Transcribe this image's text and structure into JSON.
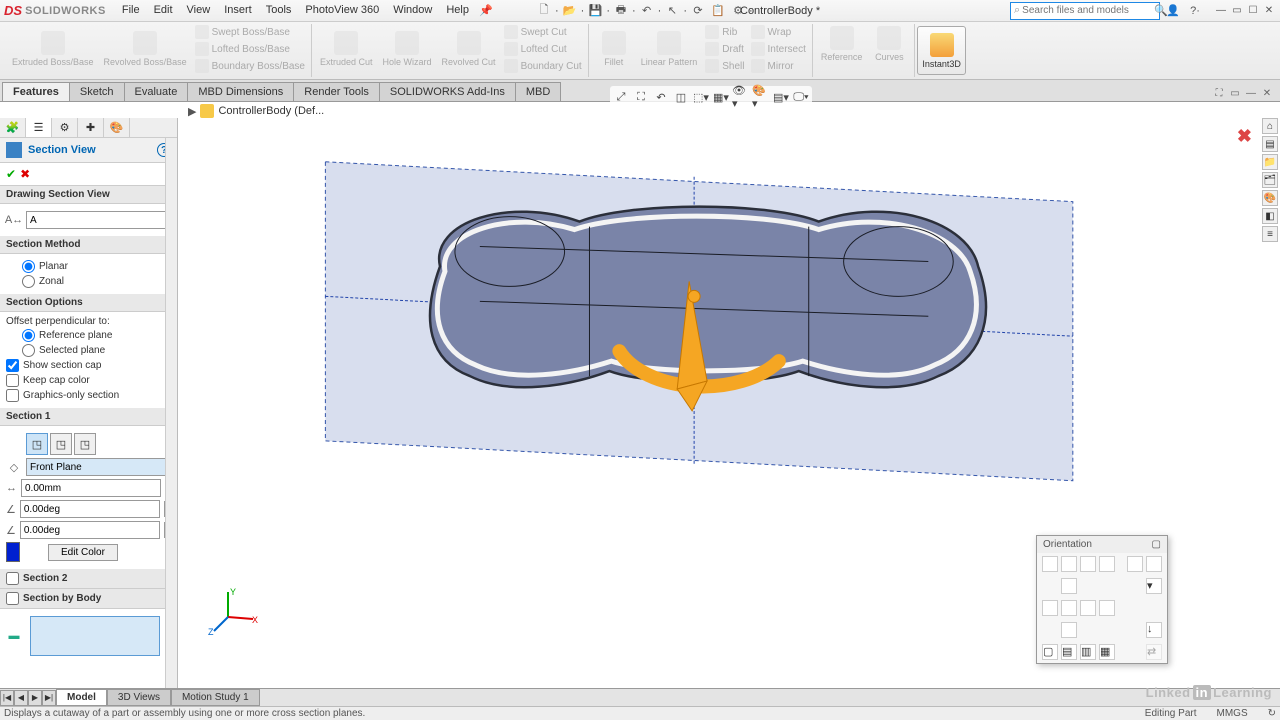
{
  "app": {
    "logo_ds": "DS",
    "logo_sw": "SOLIDWORKS",
    "doc_title": "ControllerBody *"
  },
  "menu": {
    "file": "File",
    "edit": "Edit",
    "view": "View",
    "insert": "Insert",
    "tools": "Tools",
    "photoview": "PhotoView 360",
    "window": "Window",
    "help": "Help"
  },
  "search": {
    "placeholder": "Search files and models"
  },
  "ribbon": {
    "extruded_boss": "Extruded Boss/Base",
    "revolved_boss": "Revolved Boss/Base",
    "swept_boss": "Swept Boss/Base",
    "lofted_boss": "Lofted Boss/Base",
    "boundary_boss": "Boundary Boss/Base",
    "extruded_cut": "Extruded Cut",
    "hole_wizard": "Hole Wizard",
    "revolved_cut": "Revolved Cut",
    "swept_cut": "Swept Cut",
    "lofted_cut": "Lofted Cut",
    "boundary_cut": "Boundary Cut",
    "fillet": "Fillet",
    "linear_pattern": "Linear Pattern",
    "rib": "Rib",
    "draft": "Draft",
    "shell": "Shell",
    "wrap": "Wrap",
    "intersect": "Intersect",
    "mirror": "Mirror",
    "reference": "Reference",
    "curves": "Curves",
    "instant3d": "Instant3D"
  },
  "tabs": {
    "features": "Features",
    "sketch": "Sketch",
    "evaluate": "Evaluate",
    "mbd_dim": "MBD Dimensions",
    "render": "Render Tools",
    "addins": "SOLIDWORKS Add-Ins",
    "mbd": "MBD"
  },
  "breadcrumb": {
    "doc": "ControllerBody  (Def..."
  },
  "pm": {
    "title": "Section View",
    "drawing_hdr": "Drawing Section View",
    "drawing_letter": "A",
    "method_hdr": "Section Method",
    "method_planar": "Planar",
    "method_zonal": "Zonal",
    "options_hdr": "Section Options",
    "offset_lbl": "Offset perpendicular to:",
    "ref_plane": "Reference plane",
    "sel_plane": "Selected plane",
    "show_cap": "Show section cap",
    "keep_cap": "Keep cap color",
    "gfx_only": "Graphics-only section",
    "sec1_hdr": "Section 1",
    "sec1_plane": "Front Plane",
    "sec1_off": "0.00mm",
    "sec1_a1": "0.00deg",
    "sec1_a2": "0.00deg",
    "edit_color": "Edit Color",
    "sec2_hdr": "Section 2",
    "secbody_hdr": "Section by Body"
  },
  "orientation": {
    "title": "Orientation"
  },
  "bottom": {
    "model": "Model",
    "views3d": "3D Views",
    "motion": "Motion Study 1"
  },
  "status": {
    "msg": "Displays a cutaway of a part or assembly using one or more cross section planes.",
    "mode": "Editing Part",
    "units": "MMGS"
  },
  "lil": {
    "linked": "Linked",
    "in": "in",
    "learning": "Learning"
  }
}
